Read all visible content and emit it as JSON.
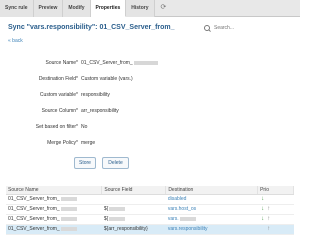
{
  "tabs": [
    {
      "label": "Sync rule",
      "active": false
    },
    {
      "label": "Preview",
      "active": false
    },
    {
      "label": "Modify",
      "active": false
    },
    {
      "label": "Properties",
      "active": true
    },
    {
      "label": "History",
      "active": false
    }
  ],
  "tab_extra_icon": "refresh-icon",
  "page_title": "Sync \"vars.responsibility\": 01_CSV_Server_from_",
  "search": {
    "placeholder": "Search..."
  },
  "back_label": "« back",
  "form": {
    "source_name": {
      "label": "Source Name*",
      "value": "01_CSV_Server_from_"
    },
    "destination_field": {
      "label": "Destination Field*",
      "value": "Custom variable (vars.)"
    },
    "custom_variable": {
      "label": "Custom variable*",
      "value": "responsibility"
    },
    "source_column": {
      "label": "Source Column*",
      "value": "arr_responsibility"
    },
    "set_based_on_filter": {
      "label": "Set based on filter*",
      "value": "No"
    },
    "merge_policy": {
      "label": "Merge Policy*",
      "value": "merge"
    }
  },
  "buttons": {
    "store": "Store",
    "delete": "Delete"
  },
  "table": {
    "headers": [
      "Source Name",
      "Source Field",
      "Destination",
      "Prio"
    ],
    "rows": [
      {
        "source": "01_CSV_Server_from_",
        "field": "",
        "destination": "disabled",
        "selected": false
      },
      {
        "source": "01_CSV_Server_from_",
        "field": "${",
        "destination": "vars.host_os",
        "selected": false
      },
      {
        "source": "01_CSV_Server_from_",
        "field": "${",
        "destination": "vars.",
        "selected": false
      },
      {
        "source": "01_CSV_Server_from_",
        "field": "${arr_responsibility}",
        "destination": "vars.responsibility",
        "selected": true
      }
    ]
  },
  "colors": {
    "accent": "#2a5e8c",
    "link": "#3e83b8",
    "selected_row": "#d8ebf7"
  }
}
